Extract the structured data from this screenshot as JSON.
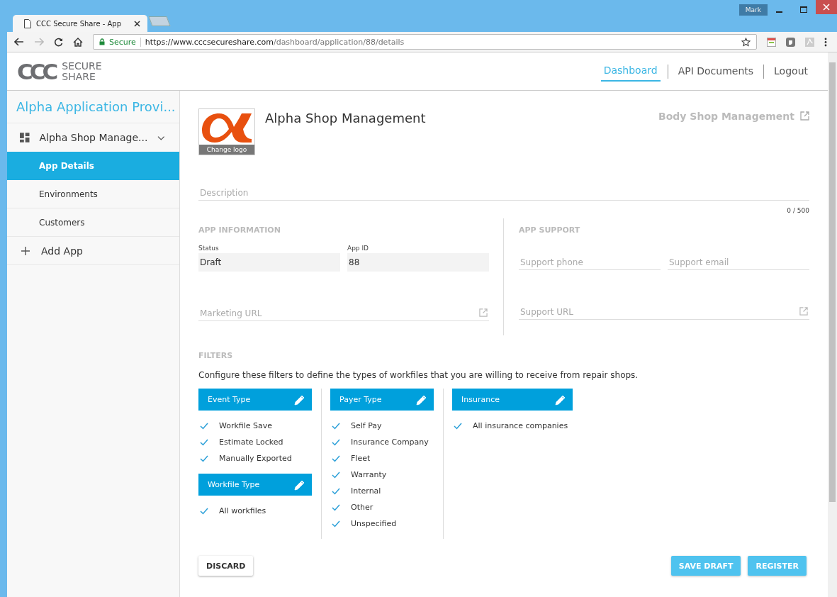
{
  "browser": {
    "tab_title": "CCC Secure Share - App",
    "user": "Mark",
    "secure_label": "Secure",
    "url_host": "https://www.cccsecureshare.com",
    "url_path": "/dashboard/application/88/details"
  },
  "header": {
    "logo_mark": "CCC",
    "logo_top": "SECURE",
    "logo_bottom": "SHARE",
    "nav": [
      {
        "label": "Dashboard",
        "selected": true
      },
      {
        "label": "API Documents",
        "selected": false
      },
      {
        "label": "Logout",
        "selected": false
      }
    ]
  },
  "sidebar": {
    "title": "Alpha Application Provi...",
    "app": {
      "label": "Alpha Shop Manage...",
      "expanded": true
    },
    "items": [
      {
        "label": "App Details",
        "selected": true
      },
      {
        "label": "Environments",
        "selected": false
      },
      {
        "label": "Customers",
        "selected": false
      }
    ],
    "add_label": "Add App"
  },
  "main": {
    "app_name": "Alpha Shop Management",
    "change_logo": "Change logo",
    "external_link": "Body Shop Management",
    "description": {
      "placeholder": "Description",
      "counter": "0 / 500"
    },
    "app_information": {
      "heading": "APP INFORMATION",
      "status": {
        "label": "Status",
        "value": "Draft"
      },
      "app_id": {
        "label": "App ID",
        "value": "88"
      },
      "marketing_url": {
        "placeholder": "Marketing URL"
      }
    },
    "app_support": {
      "heading": "APP SUPPORT",
      "phone": {
        "placeholder": "Support phone"
      },
      "email": {
        "placeholder": "Support email"
      },
      "url": {
        "placeholder": "Support URL"
      }
    },
    "filters": {
      "heading": "FILTERS",
      "intro": "Configure these filters to define the types of workfiles that you are willing to receive from repair shops.",
      "columns": [
        [
          {
            "title": "Event Type",
            "items": [
              {
                "label": "Workfile Save",
                "checked": true
              },
              {
                "label": "Estimate Locked",
                "checked": true
              },
              {
                "label": "Manually Exported",
                "checked": true
              }
            ]
          },
          {
            "title": "Workfile Type",
            "items": [
              {
                "label": "All workfiles",
                "checked": true
              }
            ]
          }
        ],
        [
          {
            "title": "Payer Type",
            "items": [
              {
                "label": "Self Pay",
                "checked": true
              },
              {
                "label": "Insurance Company",
                "checked": true
              },
              {
                "label": "Fleet",
                "checked": true
              },
              {
                "label": "Warranty",
                "checked": true
              },
              {
                "label": "Internal",
                "checked": true
              },
              {
                "label": "Other",
                "checked": true
              },
              {
                "label": "Unspecified",
                "checked": true
              }
            ]
          }
        ],
        [
          {
            "title": "Insurance",
            "items": [
              {
                "label": "All insurance companies",
                "checked": true
              }
            ]
          }
        ]
      ]
    },
    "buttons": {
      "discard": "DISCARD",
      "save_draft": "SAVE DRAFT",
      "register": "REGISTER"
    }
  }
}
